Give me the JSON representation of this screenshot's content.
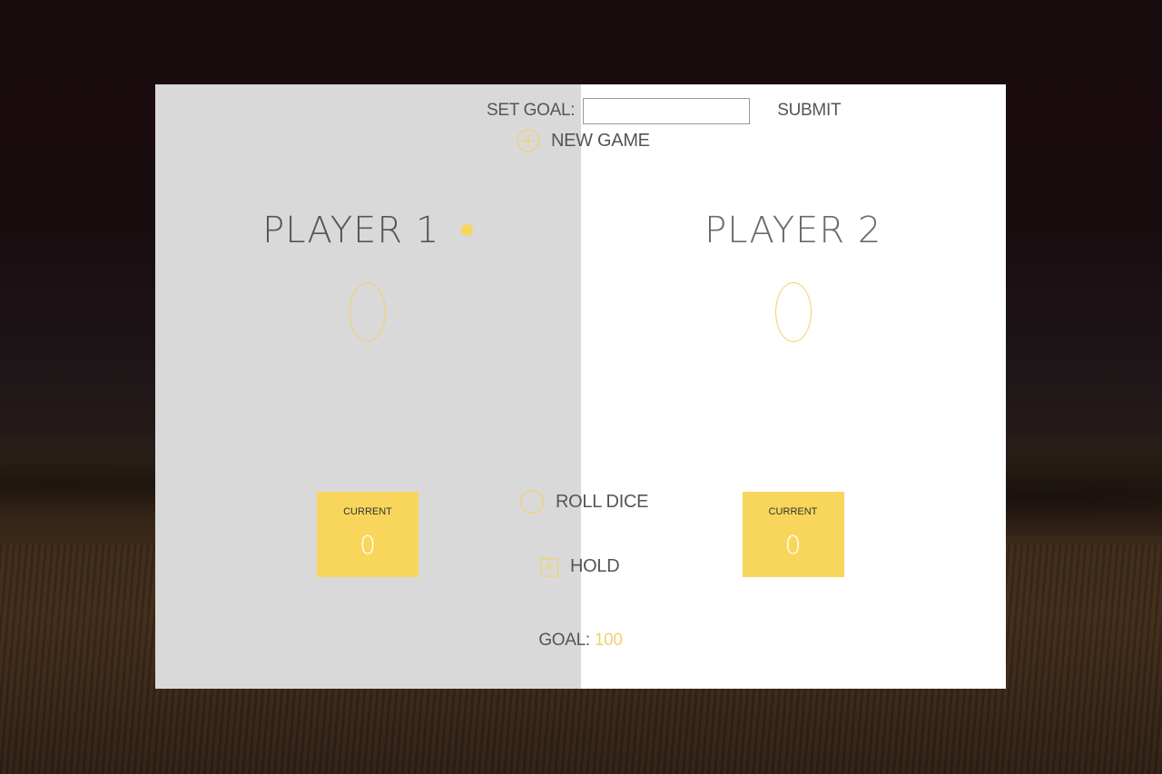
{
  "controls": {
    "set_goal_label": "SET GOAL:",
    "goal_input_value": "",
    "submit_label": "SUBMIT",
    "new_game_label": "NEW GAME",
    "roll_dice_label": "ROLL DICE",
    "hold_label": "HOLD"
  },
  "players": [
    {
      "name": "PLAYER 1",
      "score": "0",
      "current_label": "CURRENT",
      "current_score": "0",
      "active": true
    },
    {
      "name": "PLAYER 2",
      "score": "0",
      "current_label": "CURRENT",
      "current_score": "0",
      "active": false
    }
  ],
  "goal": {
    "label": "GOAL:",
    "value": "100"
  },
  "icons": {
    "new_game": "add-circle-icon",
    "roll_dice": "loop-circle-icon",
    "hold": "download-icon"
  },
  "colors": {
    "accent": "#f7d65b",
    "active_panel": "#d9d9d9",
    "inactive_panel": "#ffffff",
    "text": "#555555"
  }
}
